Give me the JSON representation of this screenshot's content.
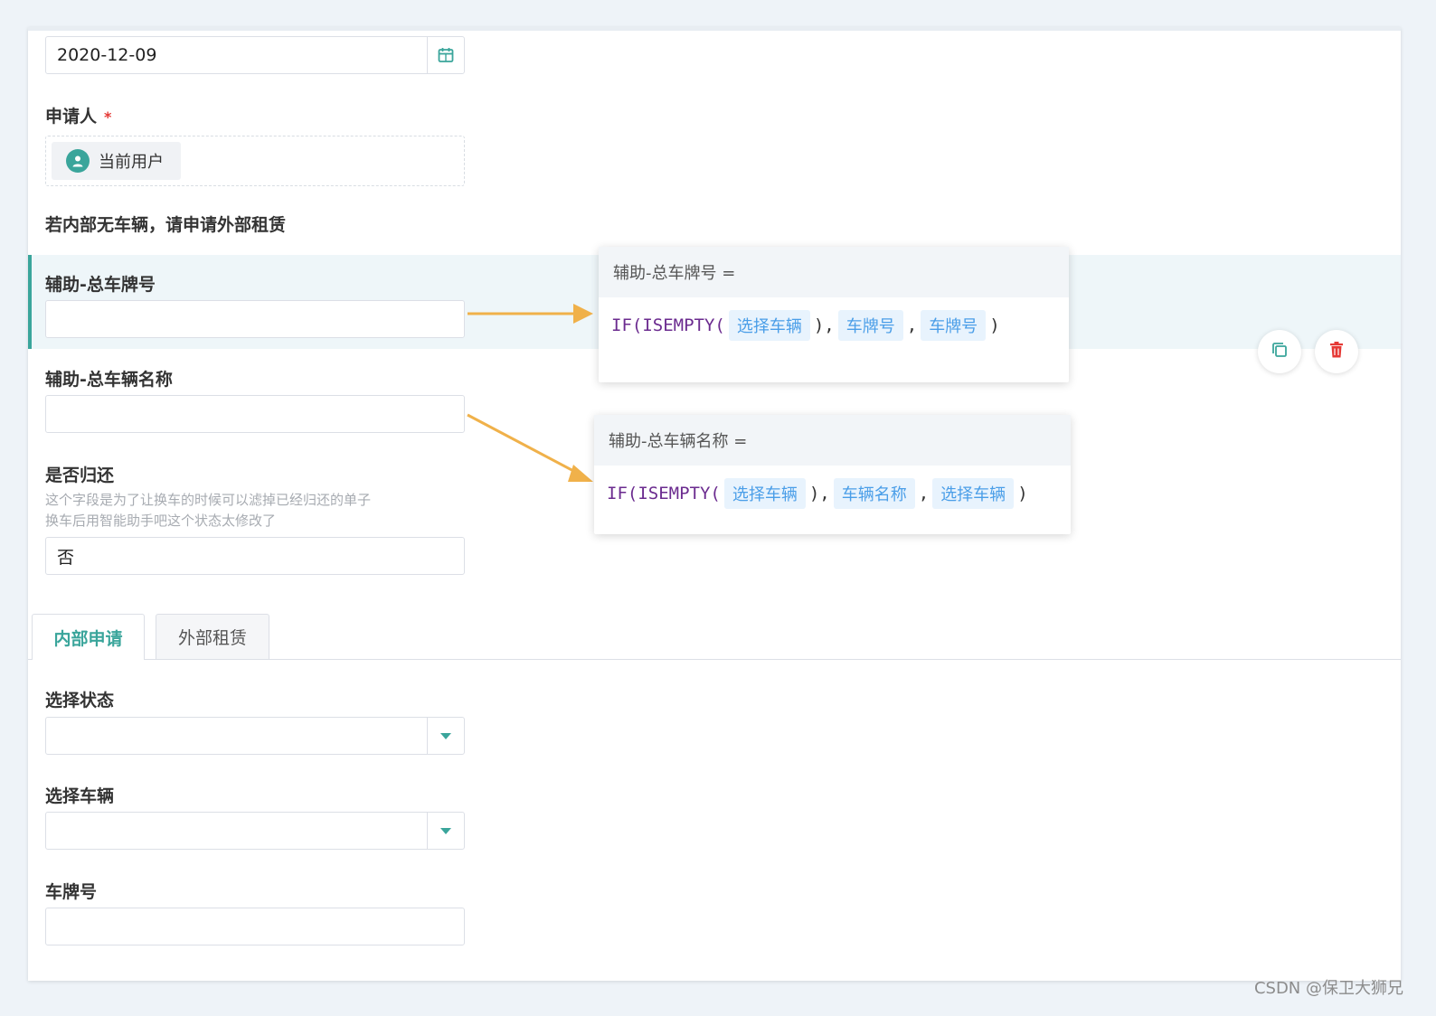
{
  "form": {
    "date_value": "2020-12-09",
    "applicant_label": "申请人",
    "required_mark": "*",
    "current_user": "当前用户",
    "notice": "若内部无车辆，请申请外部租赁",
    "aux_plate_label": "辅助-总车牌号",
    "aux_vehicle_name_label": "辅助-总车辆名称",
    "returned_label": "是否归还",
    "returned_desc_line1": "这个字段是为了让换车的时候可以滤掉已经归还的单子",
    "returned_desc_line2": "换车后用智能助手吧这个状态太修改了",
    "returned_value": "否",
    "select_status_label": "选择状态",
    "select_vehicle_label": "选择车辆",
    "plate_label": "车牌号"
  },
  "tabs": [
    {
      "label": "内部申请",
      "active": true
    },
    {
      "label": "外部租赁",
      "active": false
    }
  ],
  "popup1": {
    "title": "辅助-总车牌号 =",
    "fn": "IF(ISEMPTY(",
    "arg1": "选择车辆",
    "sep1": "),",
    "arg2": "车牌号",
    "sep2": ",",
    "arg3": "车牌号",
    "end": ")"
  },
  "popup2": {
    "title": "辅助-总车辆名称 =",
    "fn": "IF(ISEMPTY(",
    "arg1": "选择车辆",
    "sep1": "),",
    "arg2": "车辆名称",
    "sep2": ",",
    "arg3": "选择车辆",
    "end": ")"
  },
  "watermark": "CSDN @保卫大狮兄",
  "colors": {
    "accent": "#3aa59b",
    "arrow": "#f0b14a",
    "danger": "#e53935",
    "chip_bg": "#e8f3fd",
    "chip_text": "#4a9ee8"
  },
  "icons": {
    "date_suffix": "calendar-icon",
    "user": "user-icon",
    "dropdown": "caret-down-icon",
    "copy": "copy-icon",
    "delete": "trash-icon"
  }
}
